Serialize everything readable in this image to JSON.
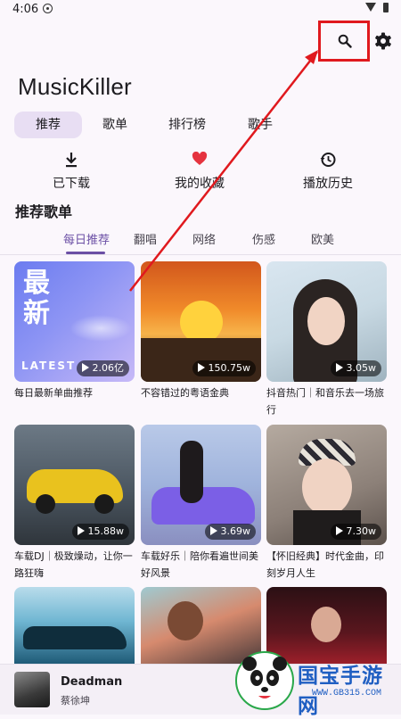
{
  "status": {
    "time": "4:06"
  },
  "app": {
    "title": "MusicKiller"
  },
  "tabs": [
    {
      "label": "推荐"
    },
    {
      "label": "歌单"
    },
    {
      "label": "排行榜"
    },
    {
      "label": "歌手"
    }
  ],
  "quick_actions": [
    {
      "label": "已下载",
      "icon": "download-icon"
    },
    {
      "label": "我的收藏",
      "icon": "heart-icon"
    },
    {
      "label": "播放历史",
      "icon": "history-icon"
    }
  ],
  "section": {
    "title": "推荐歌单"
  },
  "sub_tabs": [
    {
      "label": "每日推荐"
    },
    {
      "label": "翻唱"
    },
    {
      "label": "网络"
    },
    {
      "label": "伤感"
    },
    {
      "label": "欧美"
    }
  ],
  "playlists": [
    {
      "count": "2.06亿",
      "title": "每日最新单曲推荐",
      "cover_text_1": "最",
      "cover_text_2": "新",
      "cover_text_3": "LATEST"
    },
    {
      "count": "150.75w",
      "title": "不容错过的粤语金典"
    },
    {
      "count": "3.05w",
      "title": "抖音热门｜和音乐去一场旅行"
    },
    {
      "count": "15.88w",
      "title": "车载DJ｜极致燥动，让你一路狂嗨"
    },
    {
      "count": "3.69w",
      "title": "车载好乐｜陪你看遍世间美好风景"
    },
    {
      "count": "7.30w",
      "title": "【怀旧经典】时代金曲，印刻岁月人生"
    },
    {
      "count": "",
      "title": ""
    },
    {
      "count": "",
      "title": ""
    },
    {
      "count": "",
      "title": ""
    }
  ],
  "player": {
    "song": "Deadman",
    "artist": "蔡徐坤"
  },
  "watermark": {
    "brand": "国宝手游网",
    "site": "WWW.GB315.COM"
  },
  "colors": {
    "accent": "#6b4fa5",
    "highlight_red": "#e0191e",
    "heart": "#e5333f"
  }
}
